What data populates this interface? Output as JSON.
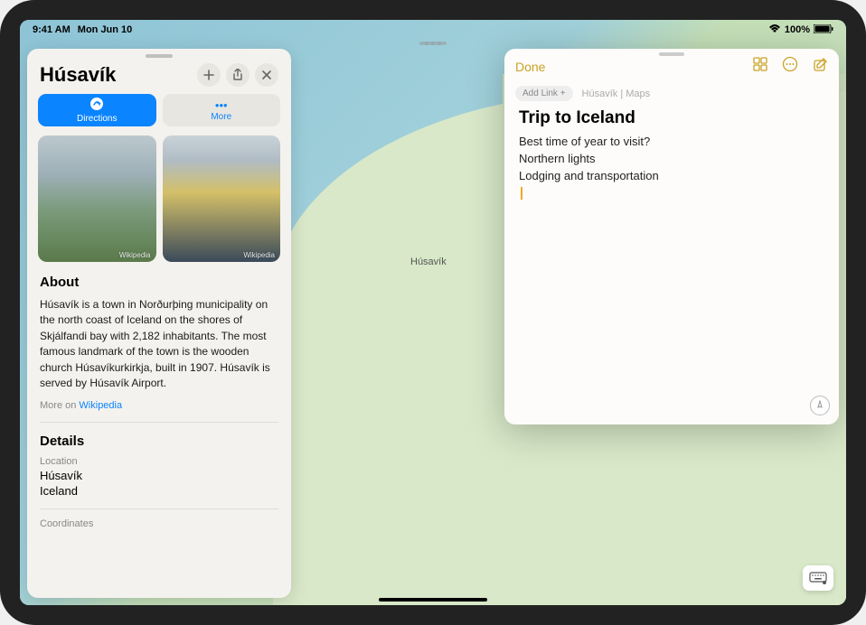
{
  "status": {
    "time": "9:41 AM",
    "date": "Mon Jun 10",
    "battery": "100%"
  },
  "maps_panel": {
    "title": "Húsavík",
    "directions_label": "Directions",
    "more_label": "More",
    "photo_attrib": "Wikipedia",
    "about_heading": "About",
    "about_text": "Húsavík is a town in Norðurþing municipality on the north coast of Iceland on the shores of Skjálfandi bay with 2,182 inhabitants. The most famous landmark of the town is the wooden church Húsavíkurkirkja, built in 1907. Húsavík is served by Húsavík Airport.",
    "more_on": "More on ",
    "more_on_link": "Wikipedia",
    "details_heading": "Details",
    "details": {
      "location_label": "Location",
      "location_value": "Húsavík\nIceland",
      "coordinates_label": "Coordinates"
    }
  },
  "notes_panel": {
    "done": "Done",
    "add_link": "Add Link +",
    "crumb": "Húsavík | Maps",
    "title": "Trip to Iceland",
    "lines": [
      "Best time of year to visit?",
      "Northern lights",
      "Lodging and transportation"
    ]
  },
  "map": {
    "place_label": "Húsavík"
  }
}
